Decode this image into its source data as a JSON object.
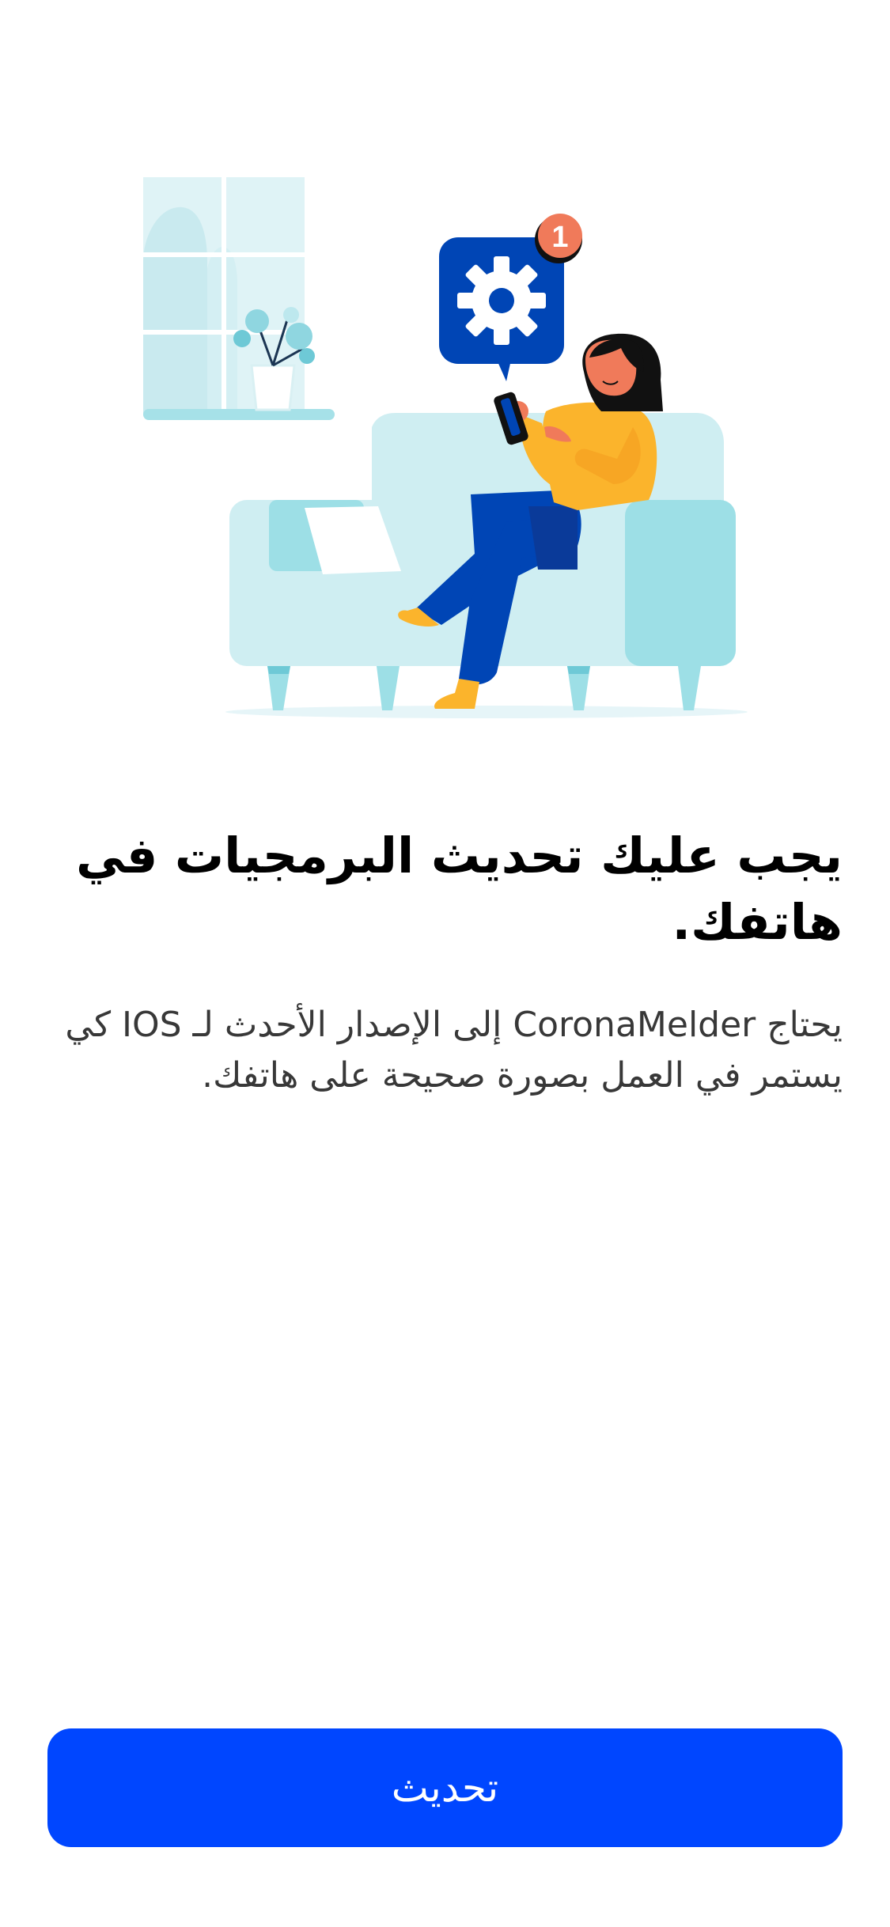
{
  "illustration": {
    "notification_badge": "1",
    "icon": "gear-icon"
  },
  "content": {
    "title": "يجب عليك تحديث البرمجيات في هاتفك.",
    "body": "يحتاج CoronaMelder إلى الإصدار الأحدث لـ IOS كي يستمر في العمل بصورة صحيحة على هاتفك."
  },
  "actions": {
    "update_label": "تحديث"
  },
  "colors": {
    "primary": "#0046ff",
    "illustration_blue": "#0045b5",
    "light_blue": "#cfeef2",
    "mid_blue": "#9ddfe6",
    "yellow": "#fbb42c",
    "badge": "#f07a5a"
  }
}
